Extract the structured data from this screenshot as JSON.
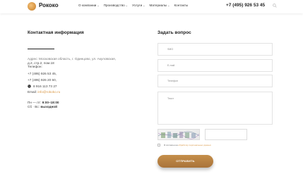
{
  "header": {
    "brand": "Рококо",
    "nav": [
      {
        "label": "О компании",
        "has_dropdown": true
      },
      {
        "label": "Производство",
        "has_dropdown": true
      },
      {
        "label": "Услуги",
        "has_dropdown": true
      },
      {
        "label": "Материалы",
        "has_dropdown": true
      },
      {
        "label": "Контакты",
        "has_dropdown": false
      }
    ],
    "phone": "+7 (495) 926 53 45",
    "chevron": "⌄"
  },
  "contacts": {
    "title": "Контактная информация",
    "address_line1": "Адрес: Московская область, г. Одинцово, ул. Акуловская,",
    "address_line2": "д.2, стр.2, пом.18",
    "phone_label": "Телефон:",
    "phone1": "+7 (495) 926 53 45,",
    "phone2": "+7 (495) 926 20 60,",
    "whatsapp": "8 916 113 73 27",
    "email_label": "Email:",
    "email": "info@rokoko.ru",
    "hours1_label": "Пн — пт:",
    "hours1_value": "9:00–18:00",
    "hours2_label": "Сб · Вс:",
    "hours2_value": "выходной"
  },
  "form": {
    "title": "Задать вопрос",
    "fio_placeholder": "ФИО",
    "email_placeholder": "E-mail",
    "phone_placeholder": "Телефон",
    "text_placeholder": "Текст",
    "consent_prefix": "Я согласен на ",
    "consent_link": "обработку персональных данных",
    "submit_label": "ОТПРАВИТЬ"
  },
  "colors": {
    "accent": "#d99745",
    "button": "#b07a3f"
  }
}
